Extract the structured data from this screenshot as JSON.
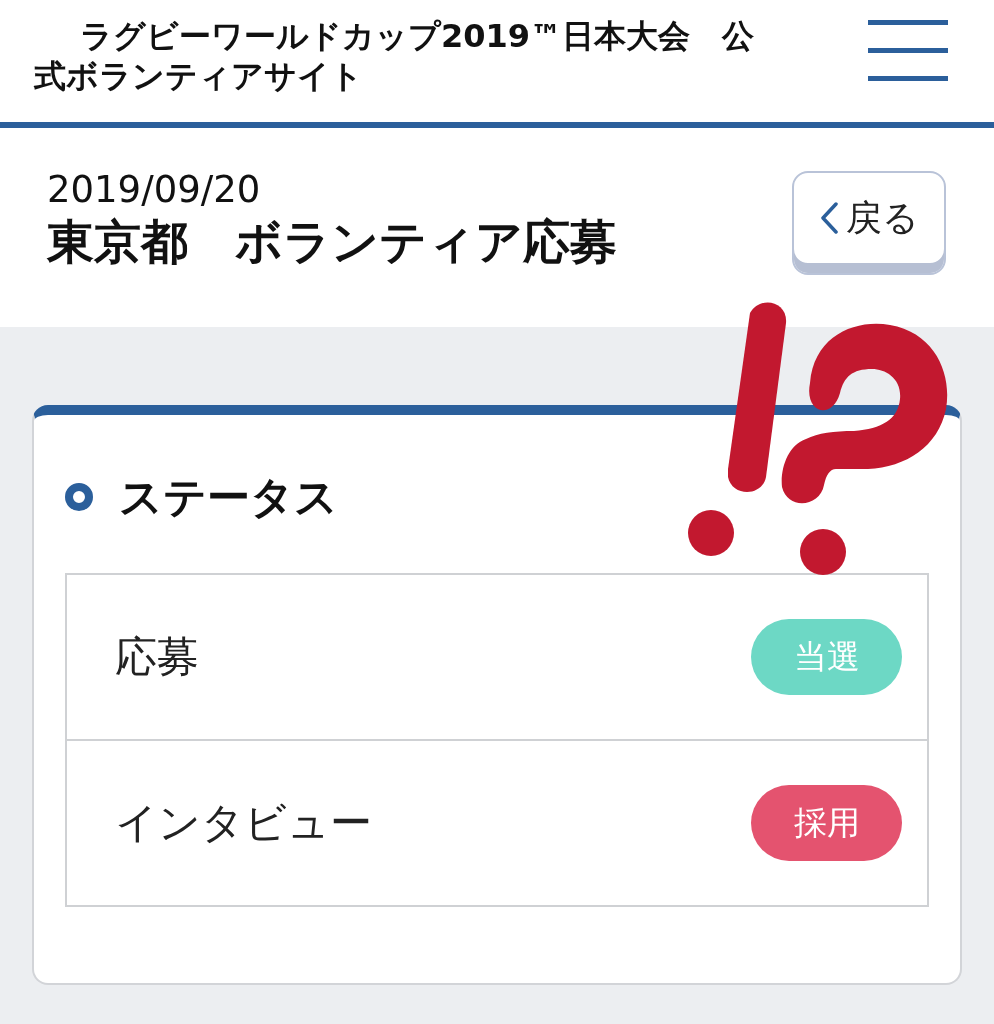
{
  "header": {
    "title": "ラグビーワールドカップ2019™日本大会　公式ボランティアサイト"
  },
  "page_header": {
    "date": "2019/09/20",
    "title": "東京都　ボランティア応募",
    "back_button": "戻る"
  },
  "status_card": {
    "heading": "ステータス",
    "rows": [
      {
        "label": "応募",
        "badge": "当選",
        "color": "#6dd8c5"
      },
      {
        "label": "インタビュー",
        "badge": "採用",
        "color": "#e4536f"
      }
    ]
  }
}
